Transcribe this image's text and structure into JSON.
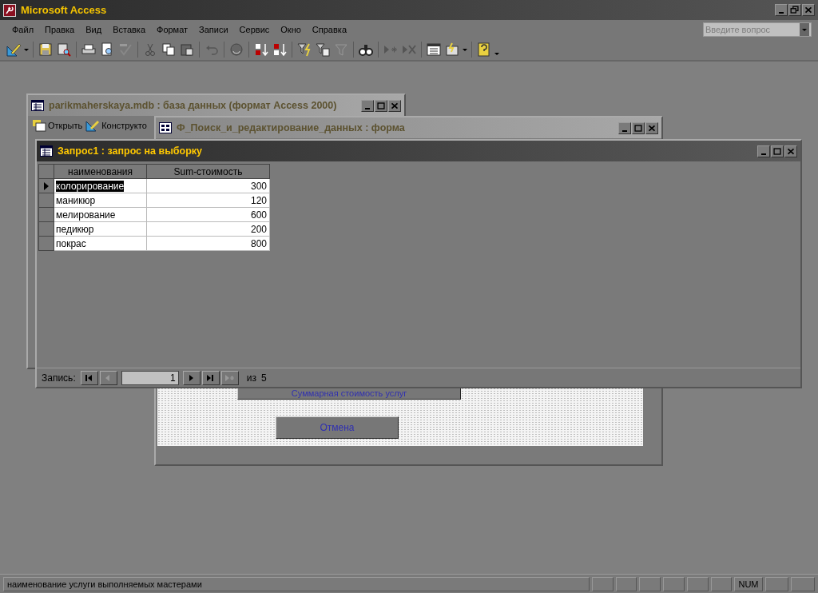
{
  "app": {
    "title": "Microsoft Access",
    "help_placeholder": "Введите вопрос"
  },
  "menu": [
    "Файл",
    "Правка",
    "Вид",
    "Вставка",
    "Формат",
    "Записи",
    "Сервис",
    "Окно",
    "Справка"
  ],
  "db_window": {
    "title": "parikmaherskaya.mdb : база данных (формат Access 2000)",
    "active": false,
    "buttons": [
      "Открыть",
      "Конструкто"
    ]
  },
  "form_window": {
    "title": "Ф_Поиск_и_редактирование_данных : форма",
    "active": false,
    "buttons": [
      {
        "label": "Суммарная стоимость услуг"
      },
      {
        "label": "Отмена"
      }
    ]
  },
  "query_window": {
    "title": "Запрос1 : запрос на выборку",
    "active": true,
    "columns": [
      "наименования",
      "Sum-стоимость"
    ],
    "rows": [
      {
        "name": "колорирование",
        "value": "300",
        "selected": true
      },
      {
        "name": "маникюр",
        "value": "120",
        "selected": false
      },
      {
        "name": "мелирование",
        "value": "600",
        "selected": false
      },
      {
        "name": "педикюр",
        "value": "200",
        "selected": false
      },
      {
        "name": "покрас",
        "value": "800",
        "selected": false
      }
    ],
    "nav": {
      "label": "Запись:",
      "current": "1",
      "of": "из",
      "total": "5",
      "buttons": [
        {
          "kind": "first",
          "disabled": false
        },
        {
          "kind": "prev",
          "disabled": true
        },
        {
          "kind": "next",
          "disabled": false
        },
        {
          "kind": "last",
          "disabled": false
        },
        {
          "kind": "new",
          "disabled": true
        }
      ]
    }
  },
  "status_bar": {
    "text": "наименование услуги выполняемых мастерами",
    "indicators": [
      {
        "text": "NUM"
      }
    ]
  }
}
